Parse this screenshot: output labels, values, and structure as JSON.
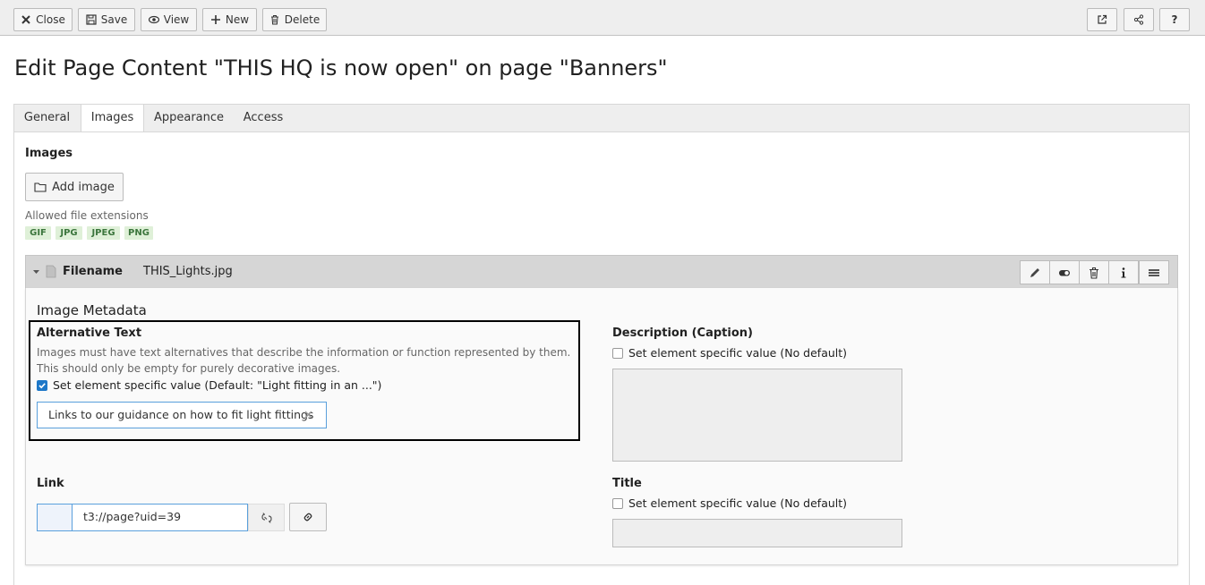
{
  "toolbar": {
    "close_label": "Close",
    "save_label": "Save",
    "view_label": "View",
    "new_label": "New",
    "delete_label": "Delete",
    "help_label": "?"
  },
  "page": {
    "title": "Edit Page Content \"THIS HQ is now open\" on page \"Banners\""
  },
  "tabs": [
    {
      "label": "General"
    },
    {
      "label": "Images",
      "active": true
    },
    {
      "label": "Appearance"
    },
    {
      "label": "Access"
    }
  ],
  "images_section": {
    "label": "Images",
    "add_image_label": "Add image",
    "allowed_label": "Allowed file extensions",
    "extensions": [
      "GIF",
      "JPG",
      "JPEG",
      "PNG"
    ]
  },
  "file_record": {
    "filename_label": "Filename",
    "filename_value": "THIS_Lights.jpg",
    "actions": [
      "edit-icon",
      "toggle-icon",
      "trash-icon",
      "info-icon",
      "menu-icon"
    ]
  },
  "metadata": {
    "heading": "Image Metadata",
    "alt_text": {
      "label": "Alternative Text",
      "help_line1": "Images must have text alternatives that describe the information or function represented by them.",
      "help_line2": "This should only be empty for purely decorative images.",
      "checkbox_label": "Set element specific value (Default: \"Light fitting in an ...\")",
      "checked": true,
      "value": "Links to our guidance on how to fit light fittings"
    },
    "description": {
      "label": "Description (Caption)",
      "checkbox_label": "Set element specific value (No default)",
      "checked": false
    },
    "link": {
      "label": "Link",
      "value": "t3://page?uid=39"
    },
    "title": {
      "label": "Title",
      "checkbox_label": "Set element specific value (No default)",
      "checked": false
    }
  },
  "colors": {
    "accent": "#1e78c8",
    "toolbar_bg": "#eeeeee",
    "badge_bg": "#dff0d8",
    "badge_text": "#3c763d",
    "file_header_bg": "#d6d6d6"
  }
}
